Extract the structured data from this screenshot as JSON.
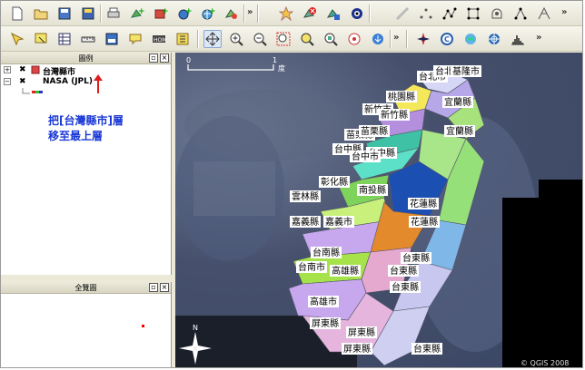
{
  "toolbar_row1": {
    "icons": [
      "new-project-icon",
      "open-project-icon",
      "save-project-icon",
      "save-as-icon",
      "print-icon",
      "add-vector-layer-icon",
      "add-raster-layer-icon",
      "add-postgis-layer-icon",
      "add-wms-layer-icon",
      "add-layer-icon",
      "toggle-editing-icon",
      "remove-layer-icon",
      "layer-properties-icon",
      "overview-icon",
      "capture-point-icon",
      "capture-line-icon",
      "capture-polygon-icon",
      "move-feature-icon",
      "split-feature-icon",
      "node-tool-icon"
    ],
    "overflow": "»"
  },
  "toolbar_row2": {
    "icons": [
      "pan-icon",
      "zoom-in-icon",
      "zoom-out-icon",
      "zoom-full-icon",
      "zoom-selection-icon",
      "zoom-layer-icon",
      "zoom-last-icon",
      "refresh-icon",
      "identify-icon",
      "select-icon",
      "measure-line-icon",
      "measure-area-icon",
      "map-tips-icon",
      "home-icon",
      "bookmarks-icon",
      "north-arrow-icon",
      "copyright-icon",
      "grid-icon",
      "gps-icon",
      "histogram-icon"
    ],
    "overflow": "»"
  },
  "legend": {
    "title": "圖例",
    "layers": [
      {
        "name": "台灣縣市",
        "checked": true,
        "expanded": false
      },
      {
        "name": "NASA (JPL)",
        "checked": true,
        "expanded": true
      }
    ],
    "note_line1": "把[台灣縣市]層",
    "note_line2": "移至最上層"
  },
  "overview": {
    "title": "全覽圖"
  },
  "map": {
    "scale_start": "0",
    "scale_end": "1",
    "scale_unit": "度",
    "copyright": "© QGIS 2008",
    "compass": "N",
    "labels": [
      "台北市",
      "台北縣",
      "基隆市",
      "桃園縣",
      "宜蘭縣",
      "新竹市",
      "新竹縣",
      "宜蘭縣",
      "苗栗縣",
      "苗栗縣",
      "台中縣",
      "台中縣",
      "台中市",
      "彰化縣",
      "南投縣",
      "花蓮縣",
      "雲林縣",
      "花蓮縣",
      "嘉義縣",
      "嘉義市",
      "台南縣",
      "台東縣",
      "台南市",
      "高雄縣",
      "台東縣",
      "台東縣",
      "高雄市",
      "屏東縣",
      "屏東縣",
      "屏東縣",
      "台東縣"
    ]
  }
}
